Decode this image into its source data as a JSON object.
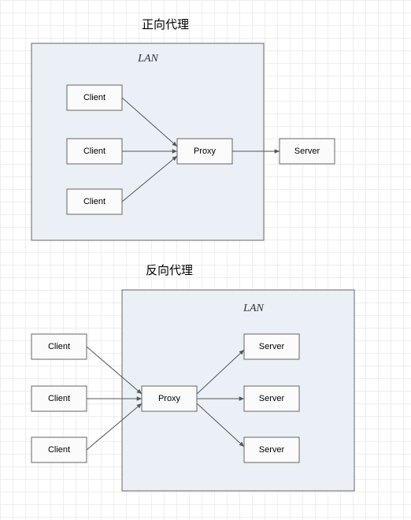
{
  "diagram1": {
    "title": "正向代理",
    "lan_label": "LAN",
    "client1": "Client",
    "client2": "Client",
    "client3": "Client",
    "proxy": "Proxy",
    "server": "Server"
  },
  "diagram2": {
    "title": "反向代理",
    "lan_label": "LAN",
    "client1": "Client",
    "client2": "Client",
    "client3": "Client",
    "proxy": "Proxy",
    "server1": "Server",
    "server2": "Server",
    "server3": "Server"
  },
  "chart_data": [
    {
      "type": "diagram",
      "title": "正向代理",
      "description": "Forward proxy: multiple clients inside a LAN connect through a Proxy to a single external Server.",
      "lan_contains": [
        "Client",
        "Client",
        "Client",
        "Proxy"
      ],
      "outside_lan": [
        "Server"
      ],
      "edges": [
        {
          "from": "Client1",
          "to": "Proxy"
        },
        {
          "from": "Client2",
          "to": "Proxy"
        },
        {
          "from": "Client3",
          "to": "Proxy"
        },
        {
          "from": "Proxy",
          "to": "Server"
        }
      ]
    },
    {
      "type": "diagram",
      "title": "反向代理",
      "description": "Reverse proxy: multiple external Clients connect to a Proxy inside a LAN which dispatches to multiple Servers inside the LAN.",
      "lan_contains": [
        "Proxy",
        "Server",
        "Server",
        "Server"
      ],
      "outside_lan": [
        "Client",
        "Client",
        "Client"
      ],
      "edges": [
        {
          "from": "Client1",
          "to": "Proxy"
        },
        {
          "from": "Client2",
          "to": "Proxy"
        },
        {
          "from": "Client3",
          "to": "Proxy"
        },
        {
          "from": "Proxy",
          "to": "Server1"
        },
        {
          "from": "Proxy",
          "to": "Server2"
        },
        {
          "from": "Proxy",
          "to": "Server3"
        }
      ]
    }
  ]
}
